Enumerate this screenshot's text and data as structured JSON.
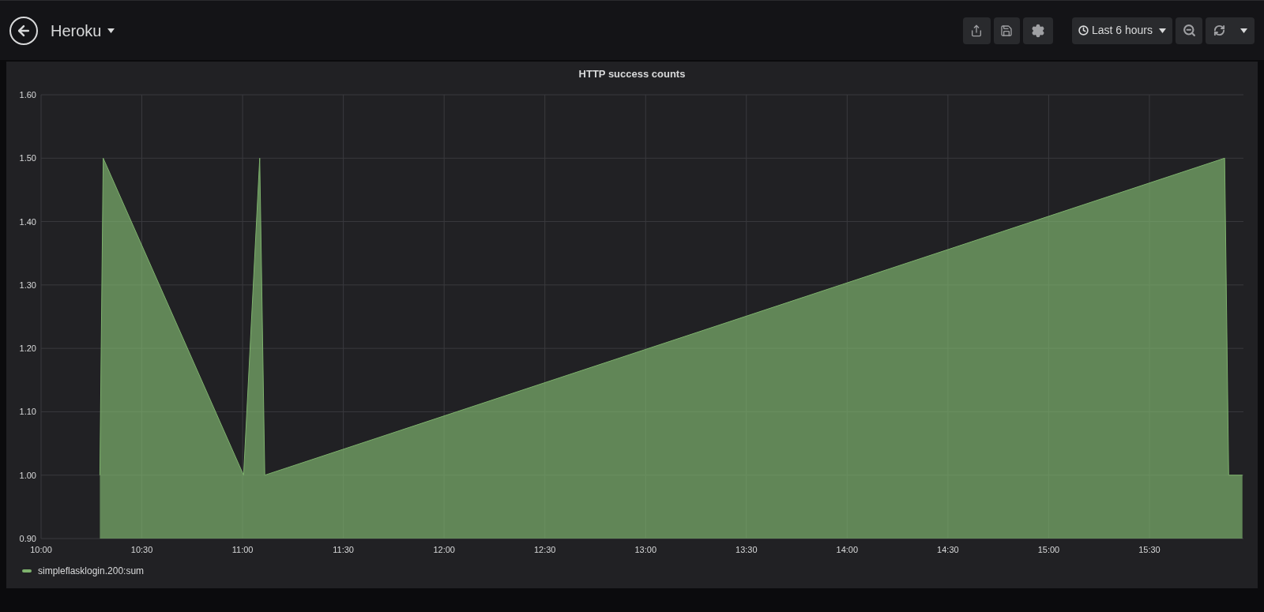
{
  "header": {
    "title": "Heroku",
    "time_range": "Last 6 hours"
  },
  "panel": {
    "chart_data": {
      "type": "area",
      "title": "HTTP success counts",
      "grid": true,
      "x": [
        10.2917,
        10.3083,
        11.005,
        11.085,
        11.11,
        15.8733,
        15.8933,
        15.9617
      ],
      "series": [
        {
          "name": "simpleflasklogin.200:sum",
          "color": "#7eb26d",
          "values": [
            1.0,
            1.5,
            1.0,
            1.5,
            1.0,
            1.5,
            1.0,
            1.0
          ]
        }
      ],
      "xlim": [
        10,
        15.9667
      ],
      "ylim": [
        0.9,
        1.6
      ],
      "xticks": [
        {
          "value": 10,
          "label": "10:00"
        },
        {
          "value": 10.5,
          "label": "10:30"
        },
        {
          "value": 11,
          "label": "11:00"
        },
        {
          "value": 11.5,
          "label": "11:30"
        },
        {
          "value": 12,
          "label": "12:00"
        },
        {
          "value": 12.5,
          "label": "12:30"
        },
        {
          "value": 13,
          "label": "13:00"
        },
        {
          "value": 13.5,
          "label": "13:30"
        },
        {
          "value": 14,
          "label": "14:00"
        },
        {
          "value": 14.5,
          "label": "14:30"
        },
        {
          "value": 15,
          "label": "15:00"
        },
        {
          "value": 15.5,
          "label": "15:30"
        }
      ],
      "yticks": [
        {
          "value": 0.9,
          "label": "0.90"
        },
        {
          "value": 1.0,
          "label": "1.00"
        },
        {
          "value": 1.1,
          "label": "1.10"
        },
        {
          "value": 1.2,
          "label": "1.20"
        },
        {
          "value": 1.3,
          "label": "1.30"
        },
        {
          "value": 1.4,
          "label": "1.40"
        },
        {
          "value": 1.5,
          "label": "1.50"
        },
        {
          "value": 1.6,
          "label": "1.60"
        }
      ]
    }
  }
}
